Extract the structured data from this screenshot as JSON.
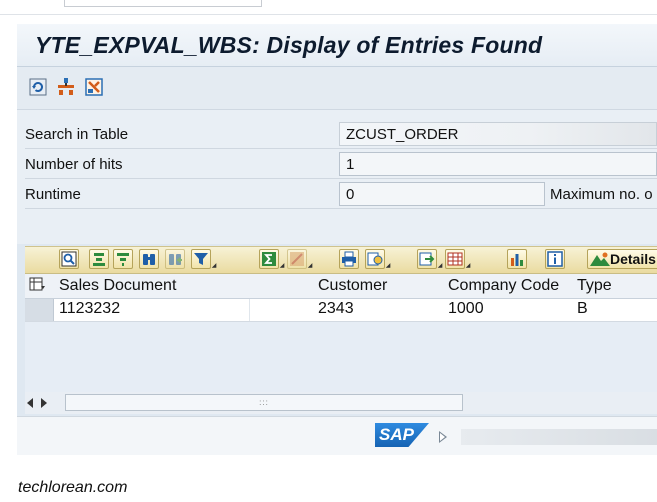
{
  "window": {
    "title": "YTE_EXPVAL_WBS: Display of Entries Found"
  },
  "app_toolbar": {
    "icons": [
      "refresh-icon",
      "where-used-icon",
      "settings-icon"
    ]
  },
  "form": {
    "rows": [
      {
        "label": "Search in Table",
        "value": "ZCUST_ORDER"
      },
      {
        "label": "Number of hits",
        "value": "1"
      },
      {
        "label": "Runtime",
        "value": "0",
        "side_label": "Maximum no. o"
      }
    ]
  },
  "alv_toolbar": {
    "details_label": "Details",
    "icons": [
      "details-icon",
      "sort-ascending-icon",
      "sort-descending-icon",
      "find-icon",
      "find-next-icon",
      "filter-icon",
      "sum-icon",
      "subtotal-icon",
      "print-icon",
      "views-icon",
      "export-icon",
      "layout-icon",
      "graphic-icon",
      "info-icon"
    ]
  },
  "grid": {
    "columns": [
      "Sales Document",
      "Customer",
      "Company Code",
      "Type"
    ],
    "rows": [
      [
        "1123232",
        "2343",
        "1000",
        "B"
      ]
    ]
  },
  "colors": {
    "title_bg": "#eef3f8",
    "frame_bg": "#dfe8f1",
    "alv_bar": "#eadba0",
    "sap_blue": "#1d6fc2"
  },
  "statusbar": {
    "logo": "SAP"
  },
  "watermark": "techlorean.com"
}
